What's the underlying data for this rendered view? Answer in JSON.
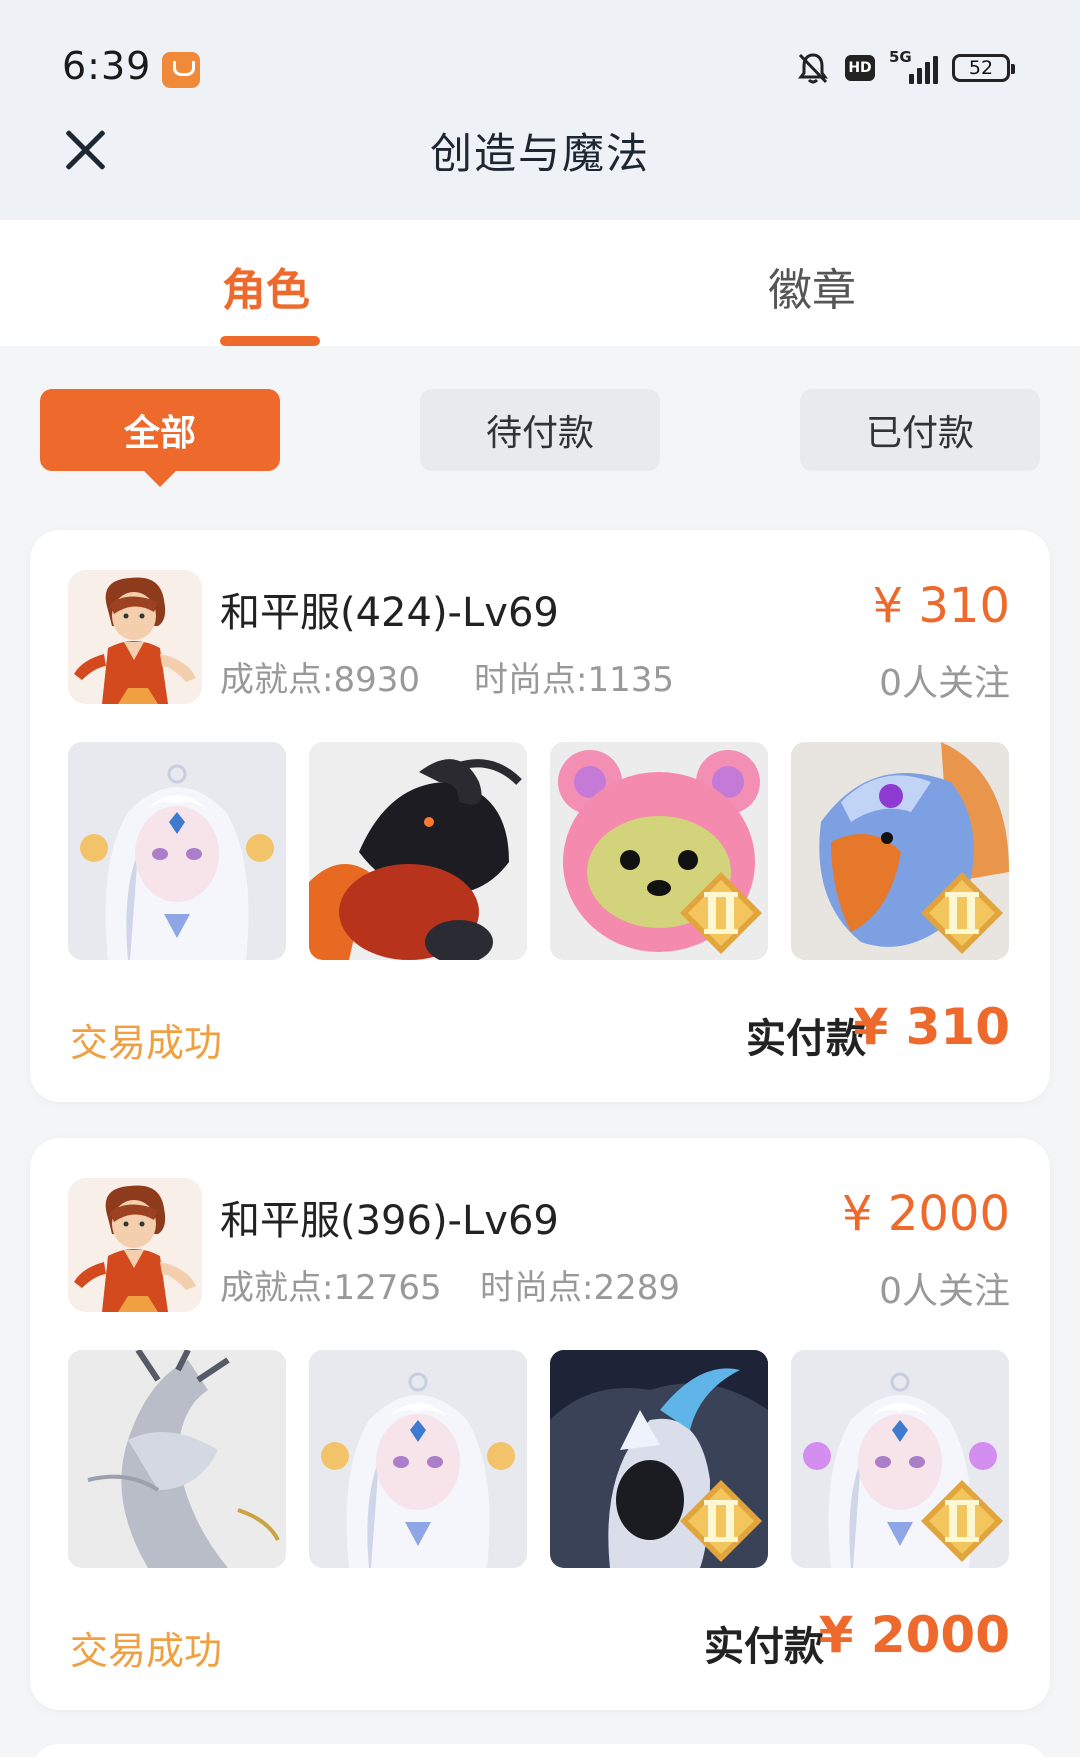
{
  "status_bar": {
    "time": "6:39",
    "network": "5G",
    "hd": "HD",
    "battery": "52",
    "icons": [
      "app-notification-icon",
      "bell-muted-icon",
      "hd-icon",
      "signal-icon",
      "battery-icon"
    ]
  },
  "nav": {
    "title": "创造与魔法",
    "close_icon": "close-icon"
  },
  "tabs": [
    {
      "label": "角色",
      "active": true
    },
    {
      "label": "徽章",
      "active": false
    }
  ],
  "filters": [
    {
      "label": "全部",
      "active": true
    },
    {
      "label": "待付款",
      "active": false
    },
    {
      "label": "已付款",
      "active": false
    }
  ],
  "orders": [
    {
      "server_name": "和平服(424)-Lv69",
      "achievement": "成就点:8930",
      "fashion": "时尚点:1135",
      "price": "¥ 310",
      "followers": "0人关注",
      "status": "交易成功",
      "paid_label": "实付款",
      "paid_amount": "¥ 310",
      "items": [
        "white-hair-spirit-character",
        "black-ram-red-beast-mount",
        "pink-bear-hood-pet",
        "blue-griffin-mount"
      ],
      "rank_badges": [
        false,
        false,
        true,
        true
      ]
    },
    {
      "server_name": "和平服(396)-Lv69",
      "achievement": "成就点:12765",
      "fashion": "时尚点:2289",
      "price": "¥ 2000",
      "followers": "0人关注",
      "status": "交易成功",
      "paid_label": "实付款",
      "paid_amount": "¥ 2000",
      "items": [
        "silver-dragon-mount",
        "white-hair-spirit-character",
        "armored-dragon-rider",
        "white-hair-spirit-pink-orbs"
      ],
      "rank_badges": [
        false,
        false,
        true,
        true
      ]
    }
  ],
  "colors": {
    "accent": "#ed6a2c",
    "status_text": "#f0a040",
    "muted_text": "#999999",
    "page_bg": "#f4f5f7",
    "header_bg": "#eef1f5"
  }
}
